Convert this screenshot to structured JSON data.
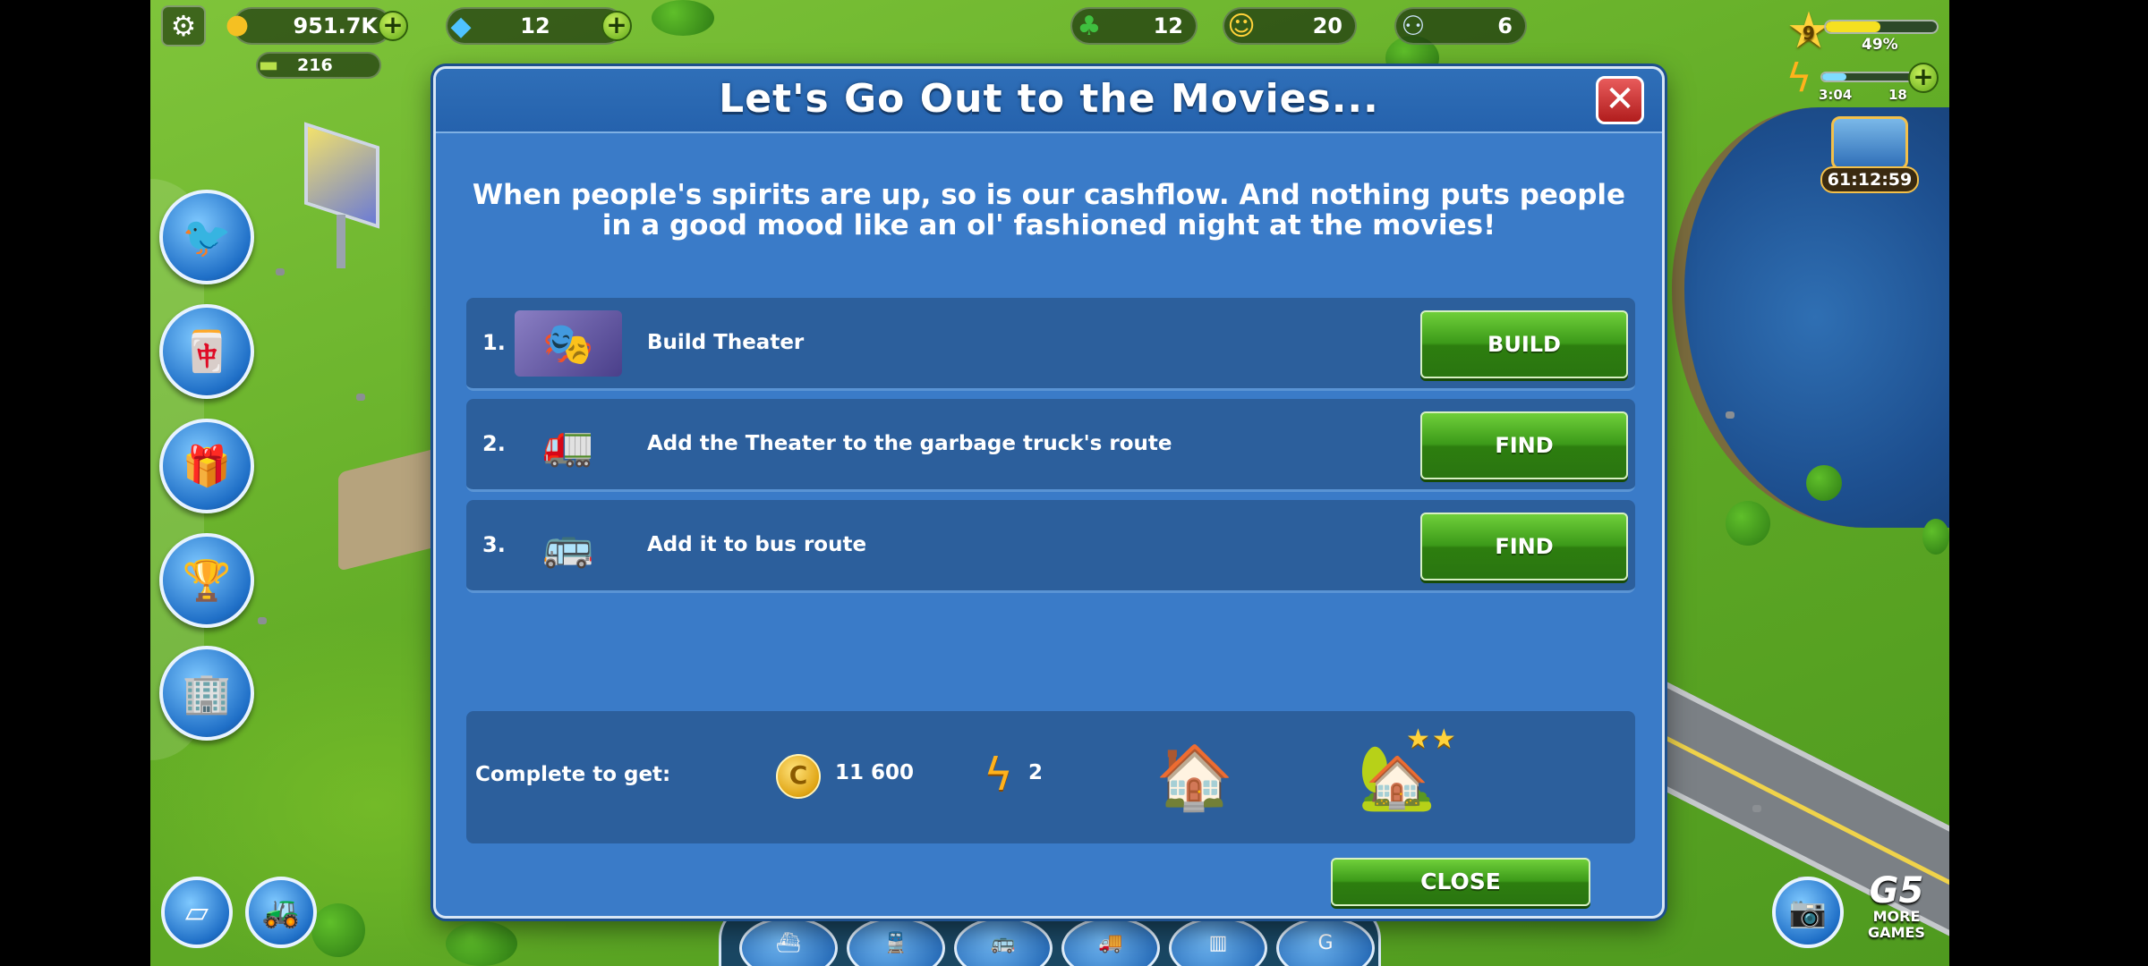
{
  "hud": {
    "coins": "951.7K",
    "gems": "12",
    "secondary_currency": "216",
    "trees": "12",
    "happiness": "20",
    "population": "6",
    "level": "9",
    "xp_percent": "49%",
    "xp_fraction": 0.49,
    "energy_timer": "3:04",
    "energy_count": "18",
    "energy_fraction": 0.25,
    "chest_timer": "61:12:59"
  },
  "dialog": {
    "title": "Let's Go Out to the Movies...",
    "description": "When people's spirits are up, so is our cashflow. And nothing puts people in a good mood like an ol' fashioned night at the movies!",
    "tasks": [
      {
        "number": "1.",
        "text": "Build Theater",
        "button": "BUILD",
        "icon": "theater-building-icon"
      },
      {
        "number": "2.",
        "text": "Add the Theater to the garbage truck's route",
        "button": "FIND",
        "icon": "garbage-truck-icon"
      },
      {
        "number": "3.",
        "text": "Add it to bus route",
        "button": "FIND",
        "icon": "bus-icon"
      }
    ],
    "reward": {
      "label": "Complete to get:",
      "coins": "11 600",
      "energy": "2",
      "items": [
        "blue-house-icon",
        "yellow-house-icon"
      ]
    },
    "close_label": "CLOSE"
  },
  "branding": {
    "g5_logo": "G5",
    "more_games_line1": "MORE",
    "more_games_line2": "GAMES"
  },
  "colors": {
    "dialog_bg": "#3a7bc8",
    "row_bg": "#2c5f9c",
    "button_green": "#3c9a19",
    "close_red": "#b11d1d"
  }
}
